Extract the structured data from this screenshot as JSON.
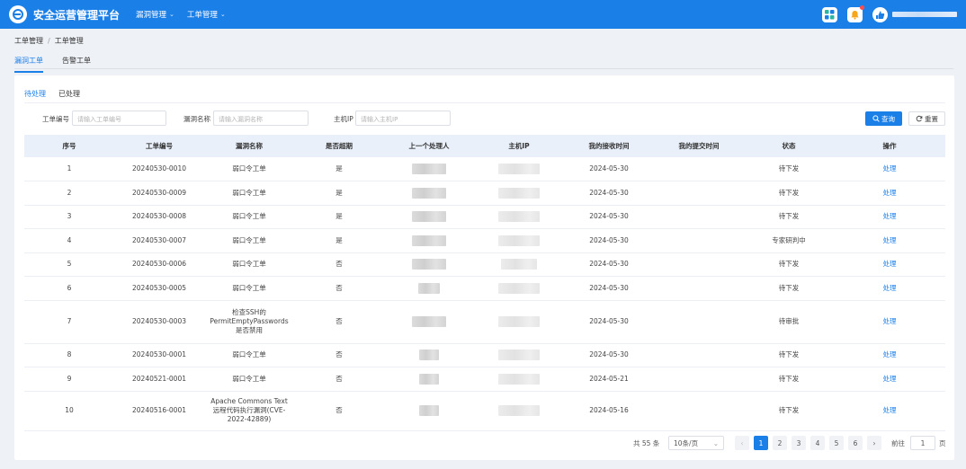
{
  "header": {
    "app_title": "安全运营管理平台",
    "nav": [
      {
        "label": "漏洞管理"
      },
      {
        "label": "工单管理"
      }
    ],
    "brand_color": "#1b7fe8"
  },
  "breadcrumb": {
    "first": "工单管理",
    "separator": "/",
    "second": "工单管理"
  },
  "page_tabs": [
    {
      "label": "漏洞工单",
      "active": true
    },
    {
      "label": "告警工单",
      "active": false
    }
  ],
  "sub_tabs": [
    {
      "label": "待处理",
      "active": true
    },
    {
      "label": "已处理",
      "active": false
    }
  ],
  "filters": {
    "order_no": {
      "label": "工单编号",
      "placeholder": "请输入工单编号"
    },
    "vuln_name": {
      "label": "漏洞名称",
      "placeholder": "请输入漏洞名称"
    },
    "host_ip": {
      "label": "主机IP",
      "placeholder": "请输入主机IP"
    },
    "search_label": "查询",
    "reset_label": "重置"
  },
  "table": {
    "columns": [
      "序号",
      "工单编号",
      "漏洞名称",
      "是否超期",
      "上一个处理人",
      "主机IP",
      "我的接收时间",
      "我的提交时间",
      "状态",
      "操作"
    ],
    "rows": [
      {
        "no": "1",
        "order_no": "20240530-0010",
        "vuln_name": "弱口令工单",
        "overdue": "是",
        "received": "2024-05-30",
        "submitted": "",
        "status": "待下发",
        "action": "处理"
      },
      {
        "no": "2",
        "order_no": "20240530-0009",
        "vuln_name": "弱口令工单",
        "overdue": "是",
        "received": "2024-05-30",
        "submitted": "",
        "status": "待下发",
        "action": "处理"
      },
      {
        "no": "3",
        "order_no": "20240530-0008",
        "vuln_name": "弱口令工单",
        "overdue": "是",
        "received": "2024-05-30",
        "submitted": "",
        "status": "待下发",
        "action": "处理"
      },
      {
        "no": "4",
        "order_no": "20240530-0007",
        "vuln_name": "弱口令工单",
        "overdue": "是",
        "received": "2024-05-30",
        "submitted": "",
        "status": "专家研判中",
        "action": "处理"
      },
      {
        "no": "5",
        "order_no": "20240530-0006",
        "vuln_name": "弱口令工单",
        "overdue": "否",
        "received": "2024-05-30",
        "submitted": "",
        "status": "待下发",
        "action": "处理"
      },
      {
        "no": "6",
        "order_no": "20240530-0005",
        "vuln_name": "弱口令工单",
        "overdue": "否",
        "received": "2024-05-30",
        "submitted": "",
        "status": "待下发",
        "action": "处理"
      },
      {
        "no": "7",
        "order_no": "20240530-0003",
        "vuln_name_lines": [
          "检查SSH的",
          "PermitEmptyPasswords",
          "是否禁用"
        ],
        "overdue": "否",
        "received": "2024-05-30",
        "submitted": "",
        "status": "待审批",
        "action": "处理"
      },
      {
        "no": "8",
        "order_no": "20240530-0001",
        "vuln_name": "弱口令工单",
        "overdue": "否",
        "received": "2024-05-30",
        "submitted": "",
        "status": "待下发",
        "action": "处理"
      },
      {
        "no": "9",
        "order_no": "20240521-0001",
        "vuln_name": "弱口令工单",
        "overdue": "否",
        "received": "2024-05-21",
        "submitted": "",
        "status": "待下发",
        "action": "处理"
      },
      {
        "no": "10",
        "order_no": "20240516-0001",
        "vuln_name_lines": [
          "Apache Commons Text",
          "远程代码执行漏洞(CVE-",
          "2022-42889)"
        ],
        "overdue": "否",
        "received": "2024-05-16",
        "submitted": "",
        "status": "待下发",
        "action": "处理"
      }
    ]
  },
  "pagination": {
    "total": "共 55 条",
    "page_size": "10条/页",
    "pages": [
      "1",
      "2",
      "3",
      "4",
      "5",
      "6"
    ],
    "current": "1",
    "goto_label": "前往",
    "goto_value": "1",
    "page_suffix": "页"
  }
}
